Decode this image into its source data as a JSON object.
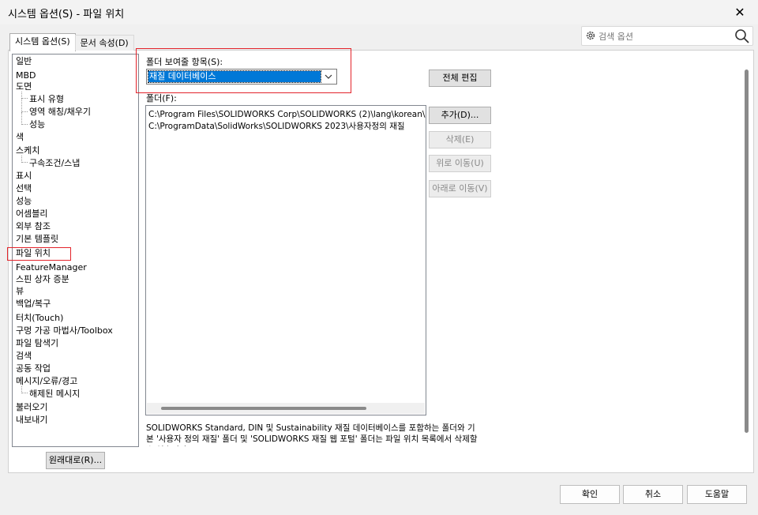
{
  "window": {
    "title": "시스템 옵션(S) - 파일 위치"
  },
  "tabs": [
    {
      "label": "시스템 옵션(S)",
      "active": true
    },
    {
      "label": "문서 속성(D)",
      "active": false
    }
  ],
  "search": {
    "placeholder": "검색 옵션",
    "value": ""
  },
  "tree": {
    "items": [
      {
        "label": "일반",
        "level": 0
      },
      {
        "label": "MBD",
        "level": 0
      },
      {
        "label": "도면",
        "level": 0
      },
      {
        "label": "표시 유형",
        "level": 1
      },
      {
        "label": "영역 해칭/채우기",
        "level": 1
      },
      {
        "label": "성능",
        "level": 1
      },
      {
        "label": "색",
        "level": 0
      },
      {
        "label": "스케치",
        "level": 0
      },
      {
        "label": "구속조건/스냅",
        "level": 1
      },
      {
        "label": "표시",
        "level": 0
      },
      {
        "label": "선택",
        "level": 0
      },
      {
        "label": "성능",
        "level": 0
      },
      {
        "label": "어셈블리",
        "level": 0
      },
      {
        "label": "외부 참조",
        "level": 0
      },
      {
        "label": "기본 템플릿",
        "level": 0
      },
      {
        "label": "파일 위치",
        "level": 0,
        "selected": true
      },
      {
        "label": "FeatureManager",
        "level": 0
      },
      {
        "label": "스핀 상자 증분",
        "level": 0
      },
      {
        "label": "뷰",
        "level": 0
      },
      {
        "label": "백업/복구",
        "level": 0
      },
      {
        "label": "터치(Touch)",
        "level": 0
      },
      {
        "label": "구멍 가공 마법사/Toolbox",
        "level": 0
      },
      {
        "label": "파일 탐색기",
        "level": 0
      },
      {
        "label": "검색",
        "level": 0
      },
      {
        "label": "공동 작업",
        "level": 0
      },
      {
        "label": "메시지/오류/경고",
        "level": 0
      },
      {
        "label": "해제된 메시지",
        "level": 1
      },
      {
        "label": "불러오기",
        "level": 0
      },
      {
        "label": "내보내기",
        "level": 0
      }
    ]
  },
  "reset_button": "원래대로(R)...",
  "folder_type": {
    "label": "폴더 보여줄 항목(S):",
    "selected": "재질 데이터베이스"
  },
  "edit_all_button": "전체 편집",
  "folders": {
    "label": "폴더(F):",
    "rows": [
      "C:\\Program Files\\SOLIDWORKS Corp\\SOLIDWORKS (2)\\lang\\korean\\sldmaterials",
      "C:\\ProgramData\\SolidWorks\\SOLIDWORKS 2023\\사용자정의 재질"
    ]
  },
  "side_buttons": {
    "add": "추가(D)...",
    "delete": "삭제(E)",
    "move_up": "위로 이동(U)",
    "move_down": "아래로 이동(V)"
  },
  "description": "SOLIDWORKS Standard, DIN 및 Sustainability 재질 데이터베이스를 포함하는 폴더와 기본 '사용자 정의 재질' 폴더 및 'SOLIDWORKS 재질 웹 포털' 폴더는 파일 위치 목록에서 삭제할 수 없습니다.",
  "footer": {
    "ok": "확인",
    "cancel": "취소",
    "help": "도움말"
  },
  "colors": {
    "selection": "#0078d7",
    "highlight_box": "#e3242b"
  }
}
